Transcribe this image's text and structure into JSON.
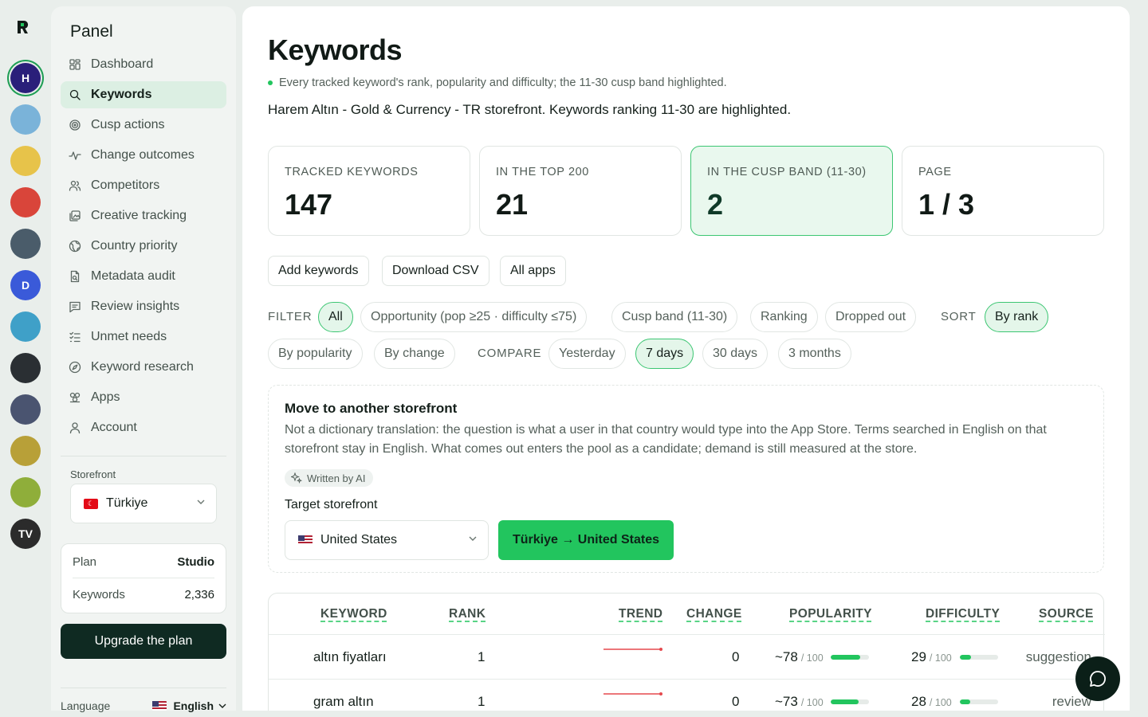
{
  "rail": {
    "apps": [
      {
        "name": "harem-altin",
        "initial": "H",
        "color": "#2a1f7a"
      },
      {
        "name": "app-2",
        "initial": "",
        "color": "#7ab3d9"
      },
      {
        "name": "app-3",
        "initial": "",
        "color": "#e7c34a"
      },
      {
        "name": "app-4",
        "initial": "",
        "color": "#d9453a"
      },
      {
        "name": "app-5",
        "initial": "",
        "color": "#4a5c6a"
      },
      {
        "name": "app-6",
        "initial": "D",
        "color": "#3a5ad9"
      },
      {
        "name": "app-7",
        "initial": "",
        "color": "#3fa0c8"
      },
      {
        "name": "app-8",
        "initial": "",
        "color": "#2a2f33"
      },
      {
        "name": "app-9",
        "initial": "",
        "color": "#4a5470"
      },
      {
        "name": "app-10",
        "initial": "",
        "color": "#b8a038"
      },
      {
        "name": "app-11",
        "initial": "",
        "color": "#8fae3a"
      },
      {
        "name": "app-12",
        "initial": "TV",
        "color": "#2b2b2b"
      }
    ]
  },
  "sidebar": {
    "title": "Panel",
    "items": [
      {
        "label": "Dashboard",
        "icon": "grid-icon"
      },
      {
        "label": "Keywords",
        "icon": "search-icon"
      },
      {
        "label": "Cusp actions",
        "icon": "target-icon"
      },
      {
        "label": "Change outcomes",
        "icon": "pulse-icon"
      },
      {
        "label": "Competitors",
        "icon": "users-icon"
      },
      {
        "label": "Creative tracking",
        "icon": "images-icon"
      },
      {
        "label": "Country priority",
        "icon": "globe-icon"
      },
      {
        "label": "Metadata audit",
        "icon": "file-icon"
      },
      {
        "label": "Review insights",
        "icon": "message-icon"
      },
      {
        "label": "Unmet needs",
        "icon": "checklist-icon"
      },
      {
        "label": "Keyword research",
        "icon": "compass-icon"
      },
      {
        "label": "Apps",
        "icon": "blocks-icon"
      },
      {
        "label": "Account",
        "icon": "user-icon"
      }
    ],
    "active_index": 1,
    "storefront_label": "Storefront",
    "storefront_value": "Türkiye",
    "plan_label": "Plan",
    "plan_value": "Studio",
    "keywords_label": "Keywords",
    "keywords_value": "2,336",
    "upgrade_label": "Upgrade the plan",
    "language_label": "Language",
    "language_value": "English"
  },
  "header": {
    "title": "Keywords",
    "subnote": "Every tracked keyword's rank, popularity and difficulty; the 11-30 cusp band highlighted.",
    "description": "Harem Altın - Gold & Currency - TR storefront. Keywords ranking 11-30 are highlighted."
  },
  "stats": [
    {
      "label": "TRACKED KEYWORDS",
      "value": "147"
    },
    {
      "label": "IN THE TOP 200",
      "value": "21"
    },
    {
      "label": "IN THE CUSP BAND (11-30)",
      "value": "2"
    },
    {
      "label": "PAGE",
      "value": "1 / 3"
    }
  ],
  "actions": {
    "add": "Add keywords",
    "download": "Download CSV",
    "all_apps": "All apps"
  },
  "filters": {
    "filter_label": "FILTER",
    "filter_options": [
      "All",
      "Opportunity (pop ≥25 · difficulty ≤75)",
      "Cusp band (11-30)",
      "Ranking",
      "Dropped out"
    ],
    "filter_selected": "All",
    "sort_label": "SORT",
    "sort_options": [
      "By rank",
      "By popularity",
      "By change"
    ],
    "sort_selected": "By rank",
    "compare_label": "COMPARE",
    "compare_options": [
      "Yesterday",
      "7 days",
      "30 days",
      "3 months"
    ],
    "compare_selected": "7 days"
  },
  "move": {
    "title": "Move to another storefront",
    "text": "Not a dictionary translation: the question is what a user in that country would type into the App Store. Terms searched in English on that storefront stay in English. What comes out enters the pool as a candidate; demand is still measured at the store.",
    "badge": "Written by AI",
    "target_label": "Target storefront",
    "target_value": "United States",
    "button": "Türkiye → United States"
  },
  "table": {
    "headers": {
      "keyword": "KEYWORD",
      "rank": "RANK",
      "trend": "TREND",
      "change": "CHANGE",
      "popularity": "POPULARITY",
      "difficulty": "DIFFICULTY",
      "source": "SOURCE"
    },
    "out_of": "/ 100",
    "rows": [
      {
        "keyword": "altın fiyatları",
        "rank": "1",
        "change": "0",
        "popularity": "~78",
        "popularity_value": 78,
        "difficulty": "29",
        "difficulty_value": 29,
        "source": "suggestion"
      },
      {
        "keyword": "gram altın",
        "rank": "1",
        "change": "0",
        "popularity": "~73",
        "popularity_value": 73,
        "difficulty": "28",
        "difficulty_value": 28,
        "source": "review"
      }
    ]
  },
  "colors": {
    "accent": "#22c55e",
    "trend_line": "#e5484d",
    "dark": "#0f2a22"
  }
}
